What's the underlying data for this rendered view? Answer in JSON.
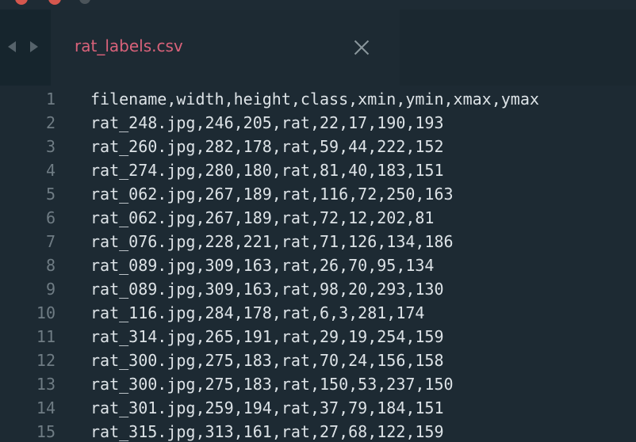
{
  "tab": {
    "filename": "rat_labels.csv"
  },
  "lines": [
    {
      "n": "1",
      "text": "filename,width,height,class,xmin,ymin,xmax,ymax"
    },
    {
      "n": "2",
      "text": "rat_248.jpg,246,205,rat,22,17,190,193"
    },
    {
      "n": "3",
      "text": "rat_260.jpg,282,178,rat,59,44,222,152"
    },
    {
      "n": "4",
      "text": "rat_274.jpg,280,180,rat,81,40,183,151"
    },
    {
      "n": "5",
      "text": "rat_062.jpg,267,189,rat,116,72,250,163"
    },
    {
      "n": "6",
      "text": "rat_062.jpg,267,189,rat,72,12,202,81"
    },
    {
      "n": "7",
      "text": "rat_076.jpg,228,221,rat,71,126,134,186"
    },
    {
      "n": "8",
      "text": "rat_089.jpg,309,163,rat,26,70,95,134"
    },
    {
      "n": "9",
      "text": "rat_089.jpg,309,163,rat,98,20,293,130"
    },
    {
      "n": "10",
      "text": "rat_116.jpg,284,178,rat,6,3,281,174"
    },
    {
      "n": "11",
      "text": "rat_314.jpg,265,191,rat,29,19,254,159"
    },
    {
      "n": "12",
      "text": "rat_300.jpg,275,183,rat,70,24,156,158"
    },
    {
      "n": "13",
      "text": "rat_300.jpg,275,183,rat,150,53,237,150"
    },
    {
      "n": "14",
      "text": "rat_301.jpg,259,194,rat,37,79,184,151"
    },
    {
      "n": "15",
      "text": "rat_315.jpg,313,161,rat,27,68,122,159"
    }
  ]
}
